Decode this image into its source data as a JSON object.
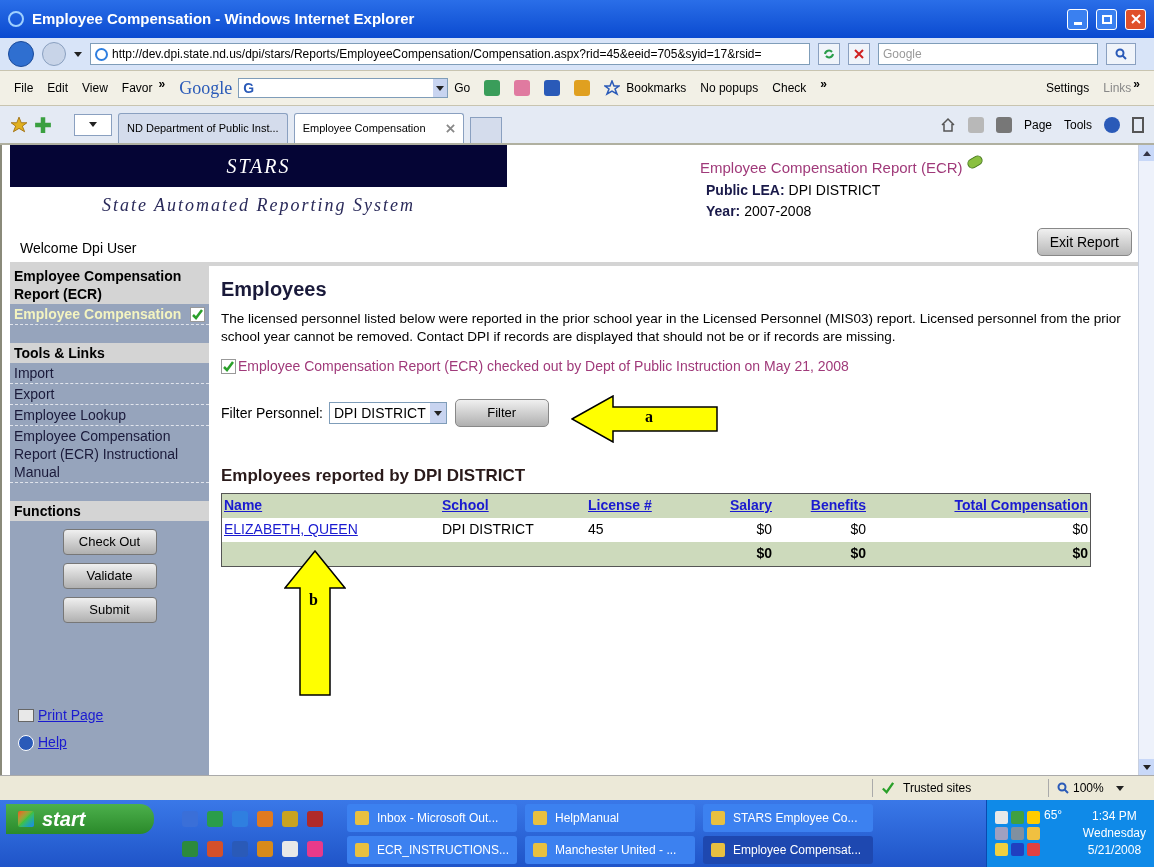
{
  "window": {
    "title": "Employee Compensation - Windows Internet Explorer"
  },
  "address_bar": {
    "url": "http://dev.dpi.state.nd.us/dpi/stars/Reports/EmployeeCompensation/Compensation.aspx?rid=45&eeid=705&syid=17&rsid=",
    "search_placeholder": "Google"
  },
  "menu": {
    "items": [
      "File",
      "Edit",
      "View",
      "Favor"
    ],
    "chevron": "»"
  },
  "google_toolbar": {
    "logo": "Google",
    "search_button": "G",
    "go": "Go",
    "bookmarks": "Bookmarks",
    "popups": "No popups",
    "check": "Check",
    "chevron": "»",
    "settings": "Settings",
    "links": "Links",
    "links_chevron": "»"
  },
  "tabs": [
    {
      "label": "ND Department of Public Inst...",
      "selected": false
    },
    {
      "label": "Employee Compensation",
      "selected": true
    }
  ],
  "command_bar": {
    "page": "Page",
    "tools": "Tools"
  },
  "header": {
    "logo_title": "STARS",
    "logo_subtitle": "State Automated Reporting System",
    "welcome": "Welcome Dpi User",
    "report_title": "Employee Compensation Report (ECR)",
    "lea_label": "Public LEA:",
    "lea_value": "DPI DISTRICT",
    "year_label": "Year:",
    "year_value": "2007-2008",
    "exit_button": "Exit Report"
  },
  "sidebar": {
    "sections": [
      {
        "title": "Employee Compensation Report (ECR)",
        "items": [
          {
            "label": "Employee Compensation",
            "selected": true,
            "checked": true
          }
        ]
      },
      {
        "title": "Tools & Links",
        "items": [
          {
            "label": "Import",
            "selected": false,
            "checked": false
          },
          {
            "label": "Export",
            "selected": false,
            "checked": false
          },
          {
            "label": "Employee Lookup",
            "selected": false,
            "checked": false
          },
          {
            "label": "Employee Compensation Report (ECR) Instructional Manual",
            "selected": false,
            "checked": false
          }
        ]
      }
    ],
    "functions": {
      "title": "Functions",
      "buttons": [
        "Check Out",
        "Validate",
        "Submit"
      ]
    },
    "links": [
      {
        "label": "Print Page",
        "kind": "print"
      },
      {
        "label": "Help",
        "kind": "help"
      }
    ]
  },
  "main": {
    "heading": "Employees",
    "description": "The licensed personnel listed below were reported in the prior school year in the Licensed Personnel (MIS03) report. Licensed personnel from the prior school year cannot be removed. Contact DPI if records are displayed that should not be or if records are missing.",
    "notice": "Employee Compensation Report (ECR) checked out by Dept of Public Instruction on May 21, 2008",
    "filter": {
      "label": "Filter Personnel:",
      "value": "DPI DISTRICT",
      "button": "Filter"
    },
    "table": {
      "title": "Employees reported by DPI DISTRICT",
      "columns": [
        {
          "label": "Name"
        },
        {
          "label": "School"
        },
        {
          "label": "License #"
        },
        {
          "label": "Salary"
        },
        {
          "label": "Benefits"
        },
        {
          "label": "Total Compensation"
        }
      ],
      "rows": [
        [
          "ELIZABETH, QUEEN",
          "DPI DISTRICT",
          "45",
          "$0",
          "$0",
          "$0"
        ]
      ],
      "totals": [
        "$0",
        "$0",
        "$0"
      ]
    }
  },
  "annotations": [
    {
      "label": "a",
      "kind": "leftarrow"
    },
    {
      "label": "b",
      "kind": "uparrow"
    }
  ],
  "status_bar": {
    "zone": "Trusted sites",
    "zoom": "100%"
  },
  "taskbar": {
    "start": "start",
    "windows": [
      "Inbox - Microsoft Out...",
      "HelpManual",
      "STARS Employee Co...",
      "ECR_INSTRUCTIONS...",
      "Manchester United - ...",
      "Employee Compensat..."
    ],
    "tray": {
      "temperature": "65°",
      "time": "1:34 PM",
      "day": "Wednesday",
      "date": "5/21/2008"
    }
  }
}
